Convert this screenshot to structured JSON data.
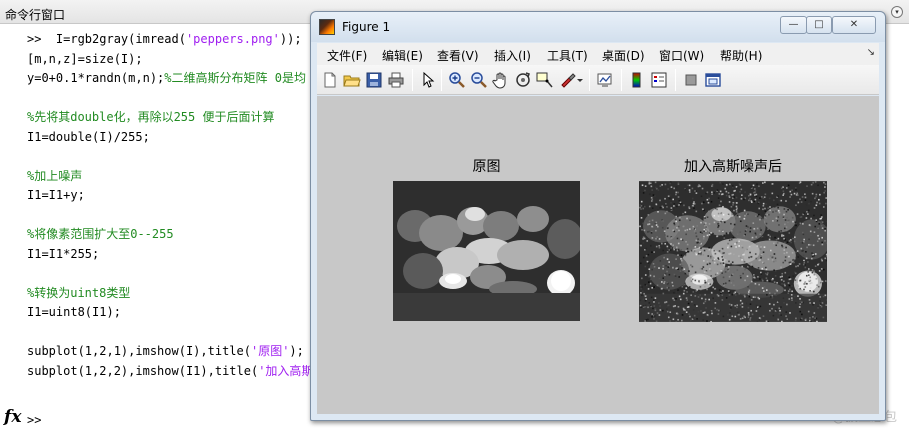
{
  "command_window": {
    "title": "命令行窗口",
    "lines": [
      [
        {
          "t": ">>  I=rgb2gray(imread(",
          "c": "prompt"
        },
        {
          "t": "'peppers.png'",
          "c": "str"
        },
        {
          "t": "));",
          "c": ""
        }
      ],
      [
        {
          "t": "[m,n,z]=size(I);",
          "c": ""
        }
      ],
      [
        {
          "t": "y=0+0.1*randn(m,n);",
          "c": ""
        },
        {
          "t": "%二维高斯分布矩阵 0是均",
          "c": "cmt"
        }
      ],
      [],
      [
        {
          "t": "%先将其double化，再除以255 便于后面计算",
          "c": "cmt"
        }
      ],
      [
        {
          "t": "I1=double(I)/255;",
          "c": ""
        }
      ],
      [],
      [
        {
          "t": "%加上噪声",
          "c": "cmt"
        }
      ],
      [
        {
          "t": "I1=I1+y;",
          "c": ""
        }
      ],
      [],
      [
        {
          "t": "%将像素范围扩大至0--255",
          "c": "cmt"
        }
      ],
      [
        {
          "t": "I1=I1*255;",
          "c": ""
        }
      ],
      [],
      [
        {
          "t": "%转换为uint8类型",
          "c": "cmt"
        }
      ],
      [
        {
          "t": "I1=uint8(I1);",
          "c": ""
        }
      ],
      [],
      [
        {
          "t": "subplot(1,2,1),imshow(I),title(",
          "c": ""
        },
        {
          "t": "'原图'",
          "c": "str"
        },
        {
          "t": ");",
          "c": ""
        }
      ],
      [
        {
          "t": "subplot(1,2,2),imshow(I1),title(",
          "c": ""
        },
        {
          "t": "'加入高斯",
          "c": "str"
        }
      ]
    ],
    "fx_label": "fx",
    "prompt": ">>"
  },
  "figure": {
    "title": "Figure 1",
    "window_buttons": {
      "minimize": "—",
      "maximize": "□",
      "close": "✕"
    },
    "menu": [
      "文件(F)",
      "编辑(E)",
      "查看(V)",
      "插入(I)",
      "工具(T)",
      "桌面(D)",
      "窗口(W)",
      "帮助(H)"
    ],
    "menu_overflow": "↘",
    "toolbar_icons": [
      "new-file-icon",
      "open-folder-icon",
      "save-icon",
      "print-icon",
      "select-arrow-icon",
      "zoom-in-icon",
      "zoom-out-icon",
      "pan-hand-icon",
      "rotate-3d-icon",
      "data-cursor-icon",
      "brush-icon",
      "brush-dropdown-icon",
      "link-plot-icon",
      "colorbar-icon",
      "legend-icon",
      "hide-plot-tools-icon",
      "show-plot-tools-icon"
    ],
    "axes": [
      {
        "title": "原图",
        "noisy": false
      },
      {
        "title": "加入高斯噪声后",
        "noisy": true
      }
    ]
  },
  "watermark": "CSDN @拔丝憨包",
  "colors": {
    "comment": "#228b22",
    "string": "#a020f0",
    "figure_bg": "#c8c8c8"
  }
}
